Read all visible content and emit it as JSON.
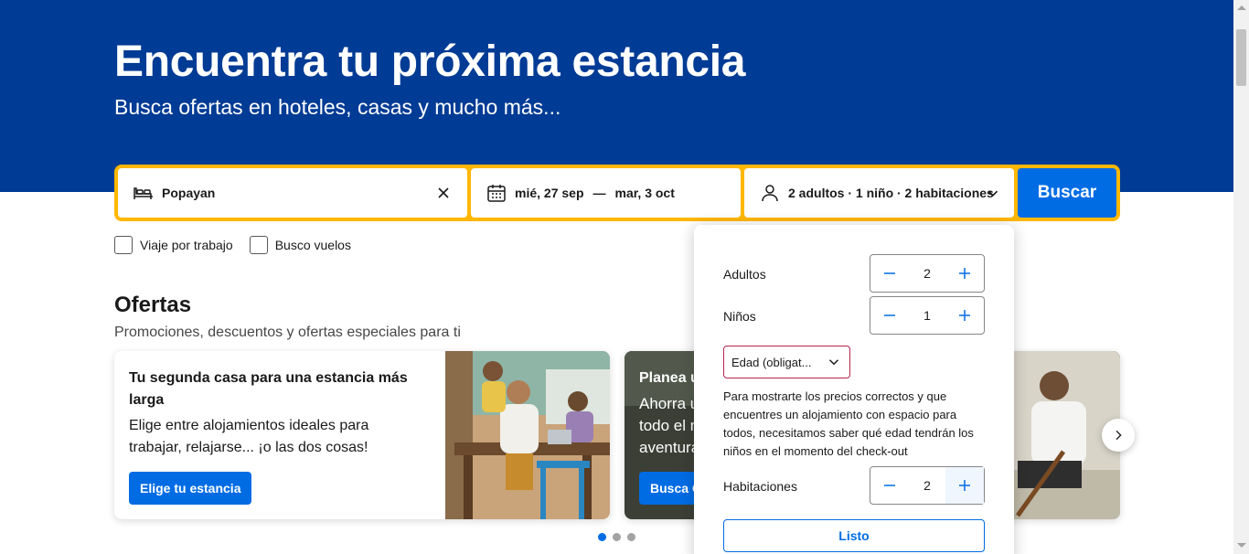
{
  "hero": {
    "title": "Encuentra tu próxima estancia",
    "subtitle": "Busca ofertas en hoteles, casas y mucho más..."
  },
  "search": {
    "destination": "Popayan",
    "date_from": "mié, 27 sep",
    "date_sep": "—",
    "date_to": "mar, 3 oct",
    "occupancy": "2 adultos · 1 niño · 2 habitaciones",
    "button_label": "Buscar"
  },
  "checkboxes": [
    {
      "label": "Viaje por trabajo",
      "checked": false
    },
    {
      "label": "Busco vuelos",
      "checked": false
    }
  ],
  "offers": {
    "title": "Ofertas",
    "subtitle": "Promociones, descuentos y ofertas especiales para ti",
    "cards": [
      {
        "heading": "Tu segunda casa para una estancia más larga",
        "text": "Elige entre alojamientos ideales para trabajar, relajarse... ¡o las dos cosas!",
        "button": "Elige tu estancia"
      },
      {
        "heading": "Planea u",
        "text_lines": [
          "Ahorra u",
          "todo el m",
          "aventura"
        ],
        "button": "Busca O"
      }
    ],
    "carousel_dots": 3,
    "active_dot": 0
  },
  "occupancy_popup": {
    "adults_label": "Adultos",
    "adults_value": "2",
    "children_label": "Niños",
    "children_value": "1",
    "age_placeholder": "Edad (obligat...",
    "age_note": "Para mostrarte los precios correctos y que encuentres un alojamiento con espacio para todos, necesitamos saber qué edad tendrán los niños en el momento del check-out",
    "rooms_label": "Habitaciones",
    "rooms_value": "2",
    "done_label": "Listo"
  },
  "colors": {
    "brand_blue": "#003b95",
    "action_blue": "#006ce4",
    "search_border": "#ffb700",
    "error_red": "#b3264f"
  }
}
